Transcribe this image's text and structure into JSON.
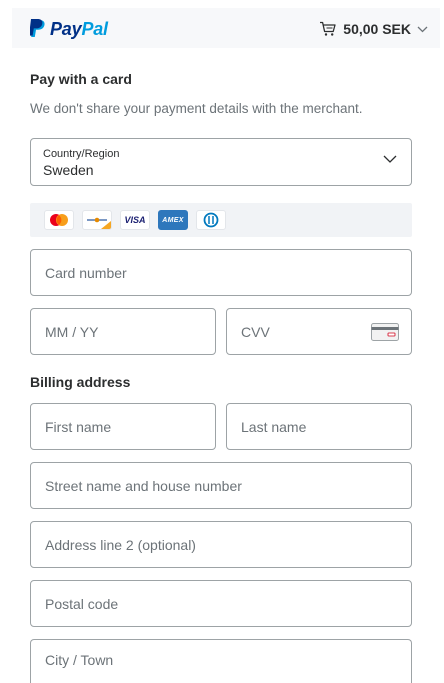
{
  "header": {
    "brand_pay": "Pay",
    "brand_pal": "Pal",
    "cart_total": "50,00 SEK"
  },
  "form": {
    "title": "Pay with a card",
    "subtitle": "We don't share your payment details with the merchant.",
    "country": {
      "label": "Country/Region",
      "value": "Sweden"
    },
    "card_logos": [
      "mastercard",
      "maestro",
      "visa",
      "amex",
      "diners"
    ],
    "card_logo_text": {
      "visa": "VISA",
      "amex": "AMEX"
    },
    "card_number_placeholder": "Card number",
    "expiry_placeholder": "MM / YY",
    "cvv_placeholder": "CVV",
    "billing_title": "Billing address",
    "first_name_placeholder": "First name",
    "last_name_placeholder": "Last name",
    "street_placeholder": "Street name and house number",
    "address2_placeholder": "Address line 2 (optional)",
    "postal_placeholder": "Postal code",
    "city_placeholder": "City / Town"
  },
  "colors": {
    "brand_dark": "#003087",
    "brand_light": "#009cde",
    "border": "#9da3a6",
    "placeholder": "#6c7378",
    "strip_bg": "#f1f3f6"
  }
}
